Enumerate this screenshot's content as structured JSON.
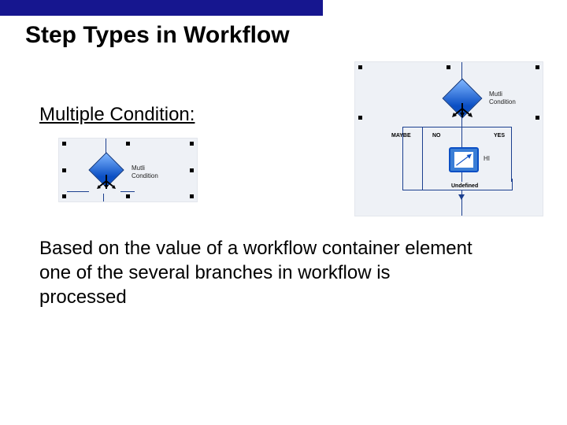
{
  "title": "Step Types in Workflow",
  "subtitle": "Multiple Condition:",
  "body": "Based on the value of a workflow  container element one of the several branches in workflow is processed",
  "small_diagram": {
    "node_label_line1": "Mutli",
    "node_label_line2": "Condition"
  },
  "large_diagram": {
    "node_label_line1": "Mutli",
    "node_label_line2": "Condition",
    "branch_left": "MAYBE",
    "branch_mid": "NO",
    "branch_right": "YES",
    "task_label": "HI",
    "join_label": "Undefined"
  }
}
